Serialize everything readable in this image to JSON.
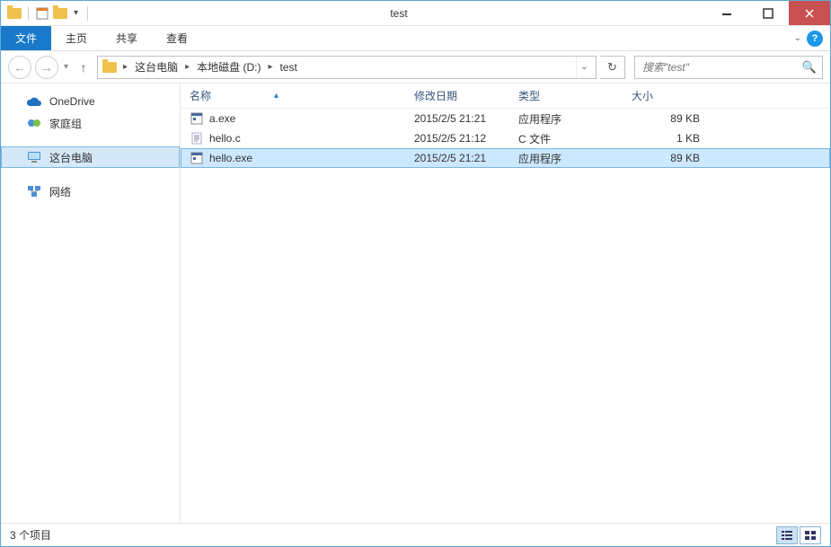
{
  "window": {
    "title": "test"
  },
  "ribbon": {
    "file": "文件",
    "tabs": [
      "主页",
      "共享",
      "查看"
    ]
  },
  "breadcrumb": {
    "segments": [
      "这台电脑",
      "本地磁盘 (D:)",
      "test"
    ]
  },
  "search": {
    "placeholder": "搜索\"test\""
  },
  "sidebar": {
    "onedrive": "OneDrive",
    "homegroup": "家庭组",
    "thispc": "这台电脑",
    "network": "网络"
  },
  "columns": {
    "name": "名称",
    "date": "修改日期",
    "type": "类型",
    "size": "大小"
  },
  "files": [
    {
      "name": "a.exe",
      "date": "2015/2/5 21:21",
      "type": "应用程序",
      "size": "89 KB",
      "icon": "exe",
      "selected": false
    },
    {
      "name": "hello.c",
      "date": "2015/2/5 21:12",
      "type": "C 文件",
      "size": "1 KB",
      "icon": "c",
      "selected": false
    },
    {
      "name": "hello.exe",
      "date": "2015/2/5 21:21",
      "type": "应用程序",
      "size": "89 KB",
      "icon": "exe",
      "selected": true
    }
  ],
  "status": {
    "count": "3 个项目"
  }
}
